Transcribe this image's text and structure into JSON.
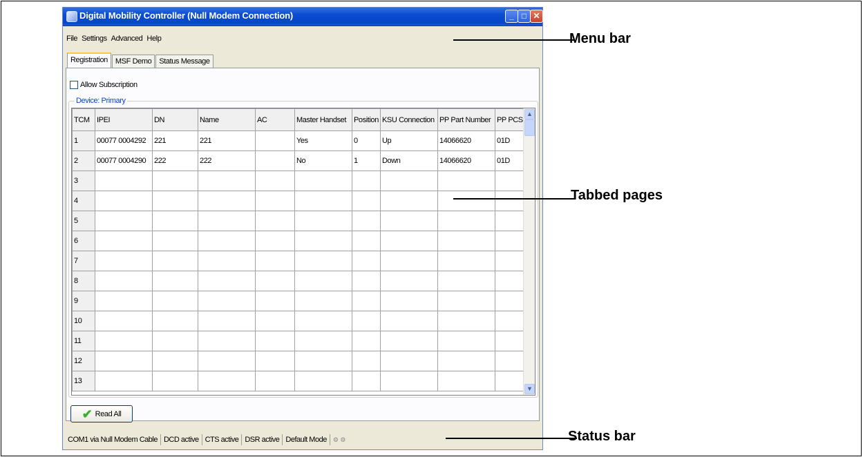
{
  "window": {
    "title": "Digital Mobility Controller (Null Modem Connection)"
  },
  "menu": [
    "File",
    "Settings",
    "Advanced",
    "Help"
  ],
  "tabs": [
    "Registration",
    "MSF Demo",
    "Status Message"
  ],
  "registration": {
    "allow_subscription_label": "Allow Subscription",
    "allow_subscription_checked": false,
    "group_label": "Device: Primary",
    "columns": [
      "TCM",
      "IPEI",
      "DN",
      "Name",
      "AC",
      "Master Handset",
      "Position",
      "KSU Connection",
      "PP Part Number",
      "PP PCS"
    ],
    "rows": [
      [
        "1",
        "00077 0004292",
        "221",
        "221",
        "",
        "Yes",
        "0",
        "Up",
        "14066620",
        "01D"
      ],
      [
        "2",
        "00077 0004290",
        "222",
        "222",
        "",
        "No",
        "1",
        "Down",
        "14066620",
        "01D"
      ],
      [
        "3",
        "",
        "",
        "",
        "",
        "",
        "",
        "",
        "",
        ""
      ],
      [
        "4",
        "",
        "",
        "",
        "",
        "",
        "",
        "",
        "",
        ""
      ],
      [
        "5",
        "",
        "",
        "",
        "",
        "",
        "",
        "",
        "",
        ""
      ],
      [
        "6",
        "",
        "",
        "",
        "",
        "",
        "",
        "",
        "",
        ""
      ],
      [
        "7",
        "",
        "",
        "",
        "",
        "",
        "",
        "",
        "",
        ""
      ],
      [
        "8",
        "",
        "",
        "",
        "",
        "",
        "",
        "",
        "",
        ""
      ],
      [
        "9",
        "",
        "",
        "",
        "",
        "",
        "",
        "",
        "",
        ""
      ],
      [
        "10",
        "",
        "",
        "",
        "",
        "",
        "",
        "",
        "",
        ""
      ],
      [
        "11",
        "",
        "",
        "",
        "",
        "",
        "",
        "",
        "",
        ""
      ],
      [
        "12",
        "",
        "",
        "",
        "",
        "",
        "",
        "",
        "",
        ""
      ],
      [
        "13",
        "",
        "",
        "",
        "",
        "",
        "",
        "",
        "",
        ""
      ]
    ],
    "read_all_label": "Read All"
  },
  "statusbar": [
    "COM1 via Null Modem Cable",
    "DCD active",
    "CTS active",
    "DSR active",
    "Default Mode"
  ],
  "callouts": {
    "menu_bar": "Menu bar",
    "tabbed_pages": "Tabbed pages",
    "status_bar": "Status bar"
  },
  "icons": {
    "app": "app-icon",
    "read_all": "check-icon",
    "status": "gear-icon"
  }
}
